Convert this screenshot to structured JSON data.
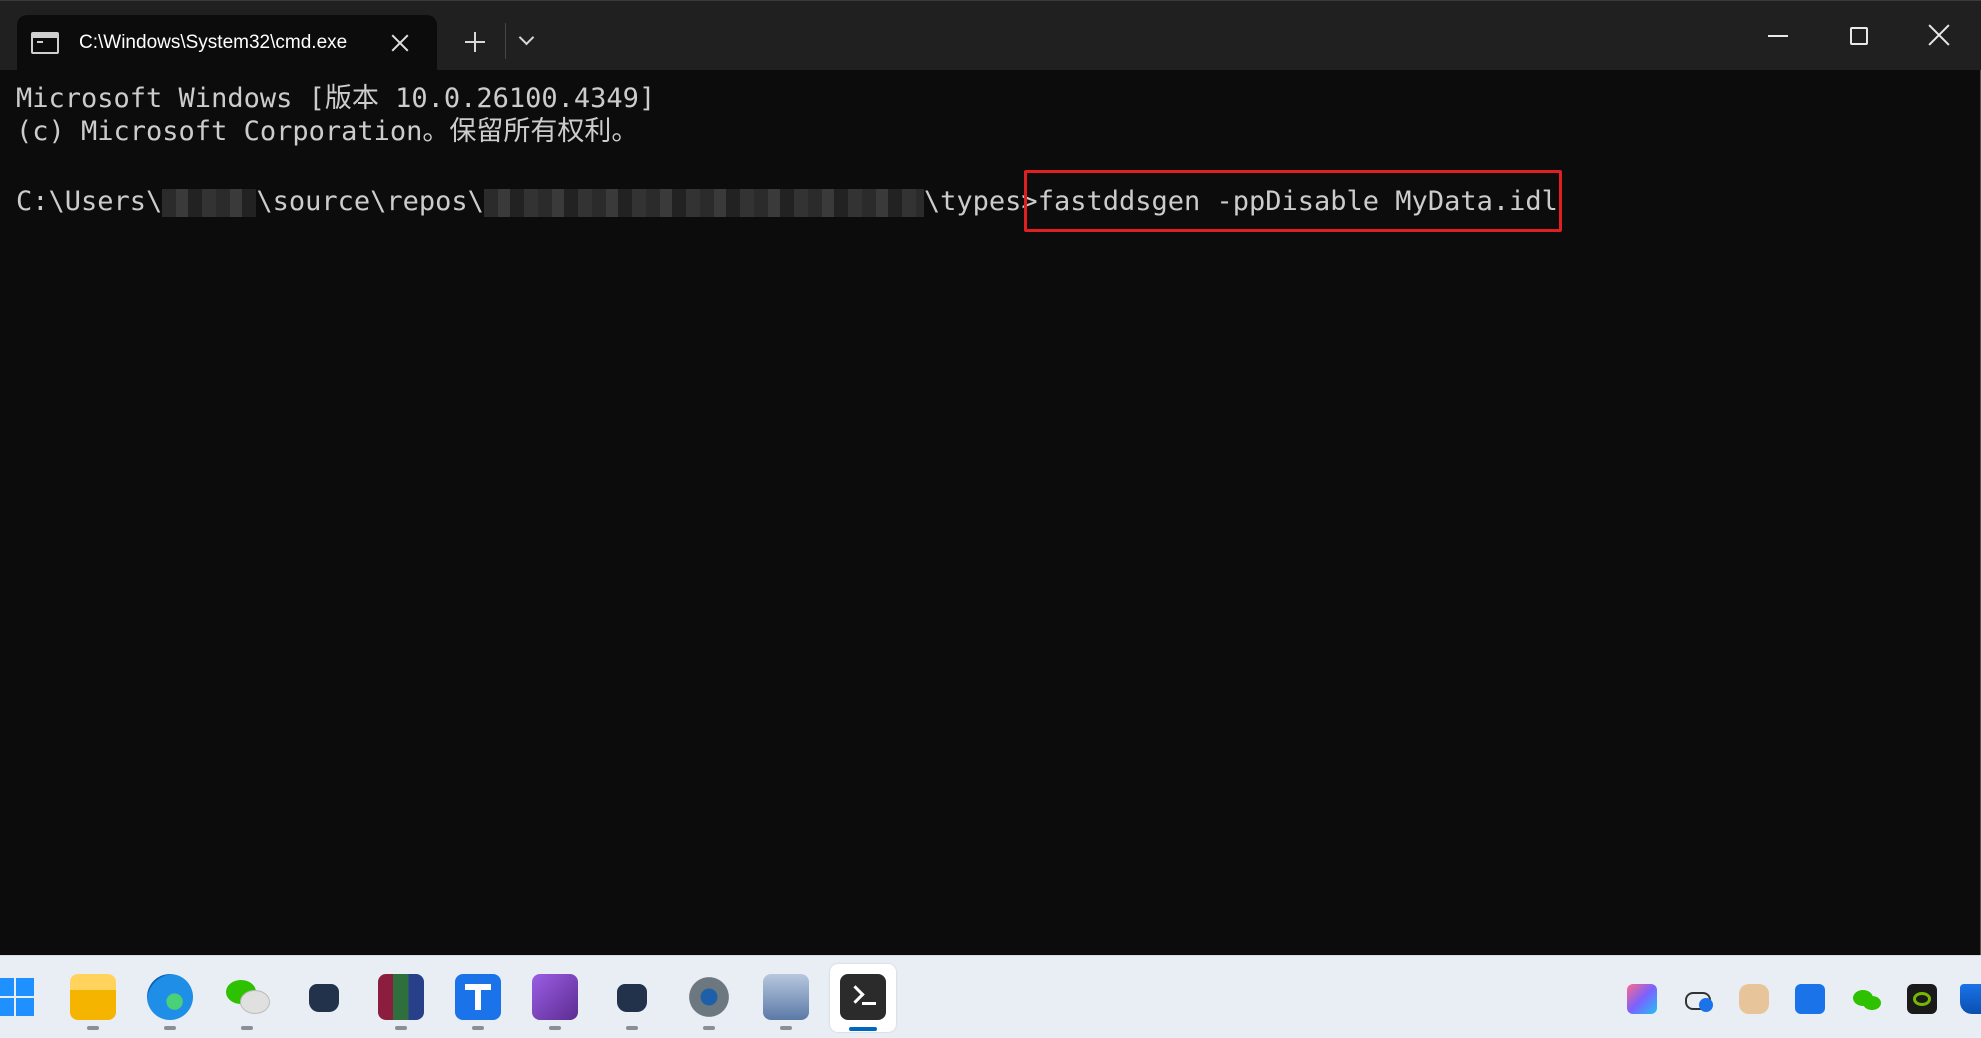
{
  "window": {
    "tab_title": "C:\\Windows\\System32\\cmd.exe",
    "tab_icon": "console-icon",
    "new_tab_icon": "plus-icon",
    "dropdown_icon": "chevron-down-icon",
    "controls": [
      "minimize-icon",
      "maximize-icon",
      "close-icon"
    ]
  },
  "terminal": {
    "line1": "Microsoft Windows [版本 10.0.26100.4349]",
    "line2": "(c) Microsoft Corporation。保留所有权利。",
    "prompt_prefix": "C:\\Users\\",
    "prompt_mid": "\\source\\repos\\",
    "prompt_suffix": "\\types>",
    "command": "fastddsgen -ppDisable MyData.idl",
    "highlight_color": "#e02020"
  },
  "taskbar": {
    "apps": [
      {
        "name": "start-button",
        "icon": "windows-logo-icon"
      },
      {
        "name": "file-explorer",
        "icon": "folder-icon"
      },
      {
        "name": "edge",
        "icon": "edge-icon"
      },
      {
        "name": "wechat",
        "icon": "wechat-icon"
      },
      {
        "name": "cat-app-1",
        "icon": "cat-icon"
      },
      {
        "name": "winrar",
        "icon": "winrar-icon"
      },
      {
        "name": "app-t",
        "icon": "t-app-icon"
      },
      {
        "name": "visual-studio",
        "icon": "visual-studio-icon"
      },
      {
        "name": "cat-app-2",
        "icon": "cat-icon"
      },
      {
        "name": "settings",
        "icon": "gear-icon"
      },
      {
        "name": "remote-desktop",
        "icon": "remote-desktop-icon"
      },
      {
        "name": "terminal",
        "icon": "terminal-icon"
      }
    ],
    "tray": [
      "m365-icon",
      "cloud-info-icon",
      "cat-face-icon",
      "t-app-icon",
      "wechat-icon",
      "nvidia-icon",
      "defender-icon"
    ]
  }
}
